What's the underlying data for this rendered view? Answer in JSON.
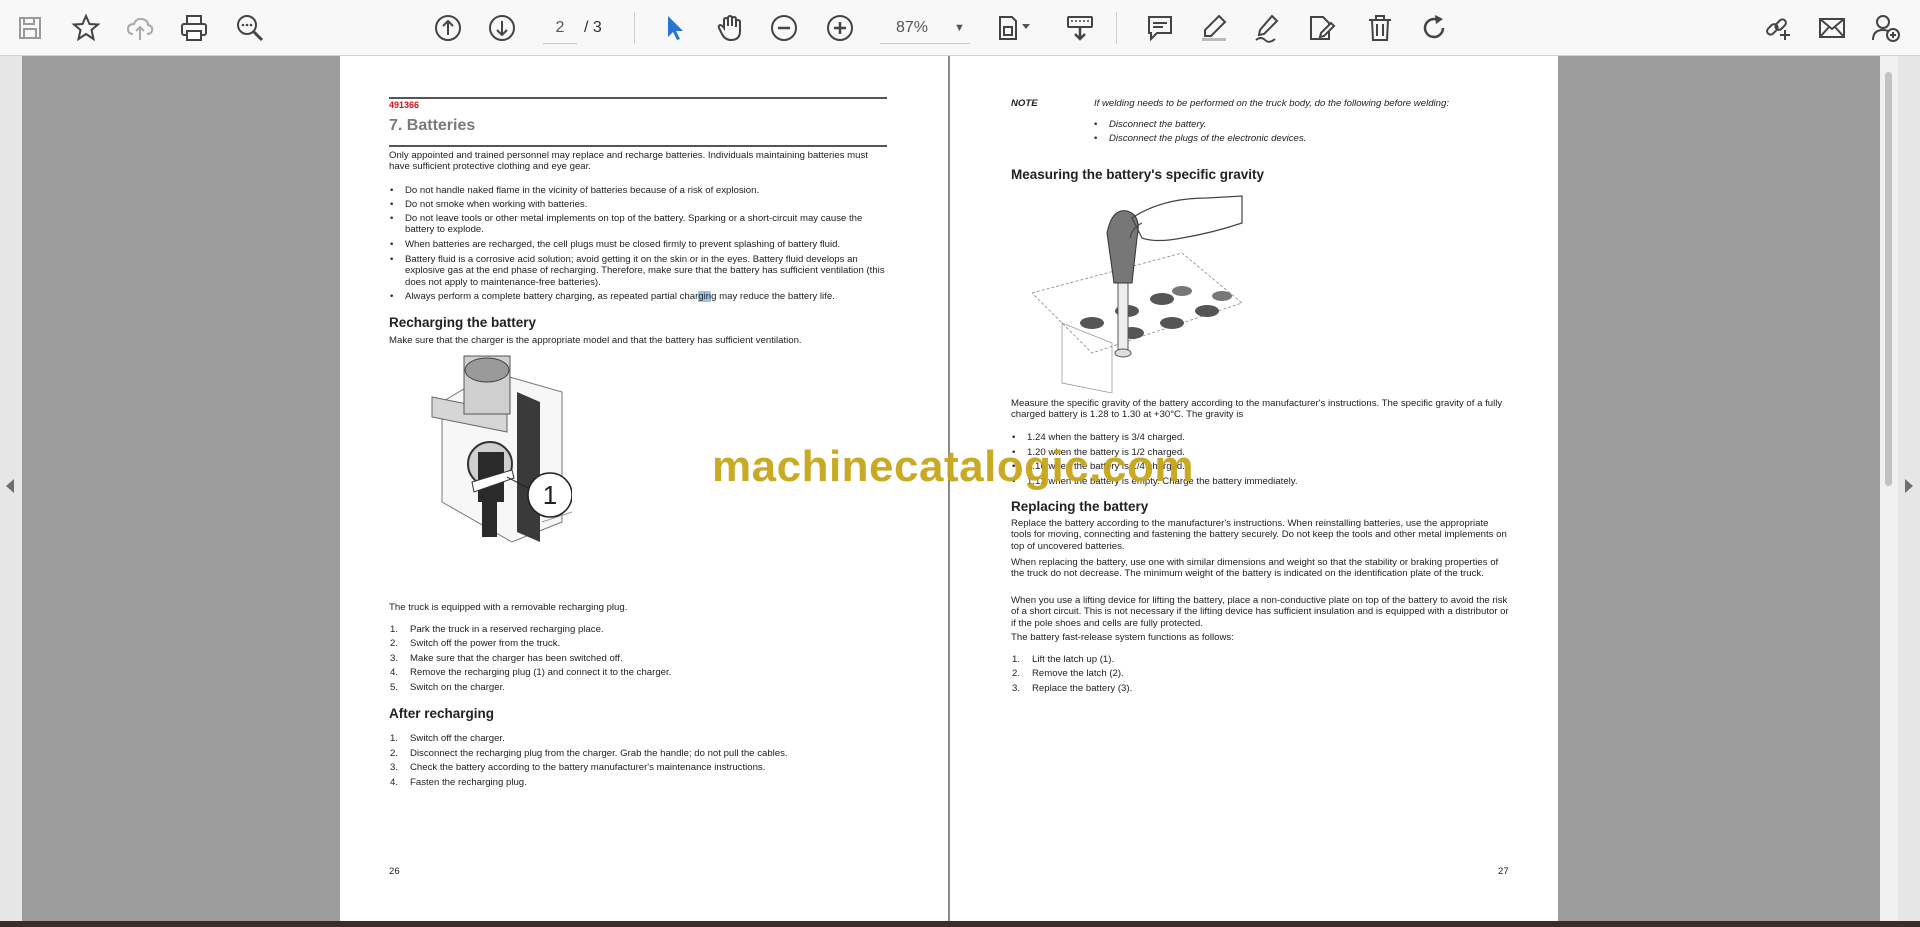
{
  "toolbar": {
    "items": [
      {
        "name": "save-icon"
      },
      {
        "name": "star-icon"
      },
      {
        "name": "upload-cloud-icon"
      },
      {
        "name": "print-icon"
      },
      {
        "name": "search-zoom-icon"
      },
      {
        "name": "page-up-icon"
      },
      {
        "name": "page-down-icon"
      },
      {
        "name": "select-cursor-icon"
      },
      {
        "name": "hand-icon"
      },
      {
        "name": "zoom-out-icon"
      },
      {
        "name": "zoom-in-icon"
      },
      {
        "name": "fit-page-icon"
      },
      {
        "name": "keyboard-scroll-icon"
      },
      {
        "name": "comment-icon"
      },
      {
        "name": "highlight-pen-icon"
      },
      {
        "name": "sign-pen-icon"
      },
      {
        "name": "stamp-icon"
      },
      {
        "name": "delete-icon"
      },
      {
        "name": "rotate-icon"
      },
      {
        "name": "share-link-icon"
      },
      {
        "name": "mail-icon"
      },
      {
        "name": "add-user-icon"
      }
    ],
    "page_current": "2",
    "page_total": "/ 3",
    "zoom": "87%",
    "accent": "#2a74d3"
  },
  "left_page": {
    "doc_code": "491366",
    "chapter_title": "7. Batteries",
    "intro": "Only appointed and trained personnel may replace and recharge batteries. Individuals maintaining batteries must have sufficient protective clothing and eye gear.",
    "bullets": [
      "Do not handle naked flame in the vicinity of batteries because of a risk of explosion.",
      "Do not smoke when working with batteries.",
      "Do not leave tools or other metal implements on top of the battery. Sparking or a short-circuit may cause the battery to explode.",
      "When batteries are recharged, the cell plugs must be closed firmly to prevent splashing of battery fluid.",
      "Battery fluid is a corrosive acid solution; avoid getting it on the skin or in the eyes. Battery fluid develops an explosive gas at the end phase of recharging. Therefore, make sure that the battery has sufficient ventilation (this does not apply to maintenance-free batteries)."
    ],
    "bullet_last_pre": "Always perform a complete battery charging, as repeated partial char",
    "bullet_last_hl": "gin",
    "bullet_last_post": "g may reduce the battery life.",
    "recharging_title": "Recharging the battery",
    "recharging_intro": "Make sure that the charger is the appropriate model and that the battery has sufficient ventilation.",
    "figure_callout": "1",
    "plug_note": "The truck is equipped with a removable recharging plug.",
    "steps": [
      "Park the truck in a reserved recharging place.",
      "Switch off the power from the truck.",
      "Make sure that the charger has been switched off.",
      "Remove the recharging plug (1) and connect it to the charger.",
      "Switch on the charger."
    ],
    "after_title": "After recharging",
    "after_steps": [
      "Switch off the charger.",
      "Disconnect the recharging plug from the charger. Grab the handle; do not pull the cables.",
      "Check the battery according to the battery manufacturer's maintenance instructions.",
      "Fasten the recharging plug."
    ],
    "page_number": "26"
  },
  "right_page": {
    "note_label": "NOTE",
    "note_text": "If welding needs to be performed on the truck body, do the following before welding:",
    "note_bullets": [
      "Disconnect the battery.",
      "Disconnect the plugs of the electronic devices."
    ],
    "gravity_title": "Measuring the battery's specific gravity",
    "gravity_text": "Measure the specific gravity of the battery according to the manufacturer's instructions. The specific gravity of a fully charged battery is 1.28 to 1.30 at +30°C. The gravity is",
    "gravity_bullets": [
      "1.24 when the battery is 3/4 charged.",
      "1.20 when the battery is 1/2 charged.",
      "1.16 when the battery is 1/4 charged.",
      "1.12 when the battery is empty. Charge the battery immediately."
    ],
    "replace_title": "Replacing the battery",
    "replace_p1": "Replace the battery according to the manufacturer's instructions. When reinstalling batteries, use the appropriate tools for moving, connecting and fastening the battery securely. Do not keep the tools and other metal implements on top of uncovered batteries.",
    "replace_p2": "When replacing the battery, use one with similar dimensions and weight so that the stability or braking properties of the truck do not decrease. The minimum weight of the battery is indicated on the identification plate of the truck.",
    "replace_p3": "When you use a lifting device for lifting the battery, place a non-conductive plate on top of the battery to avoid the risk of a short circuit. This is not necessary if the lifting device has sufficient insulation and is equipped with a distributor or if the pole shoes and cells are fully protected.",
    "replace_p4": "The battery fast-release system functions as follows:",
    "replace_steps": [
      "Lift the latch up (1).",
      "Remove the latch (2).",
      "Replace the battery (3)."
    ],
    "page_number": "27"
  },
  "watermark": "machinecatalogic.com"
}
